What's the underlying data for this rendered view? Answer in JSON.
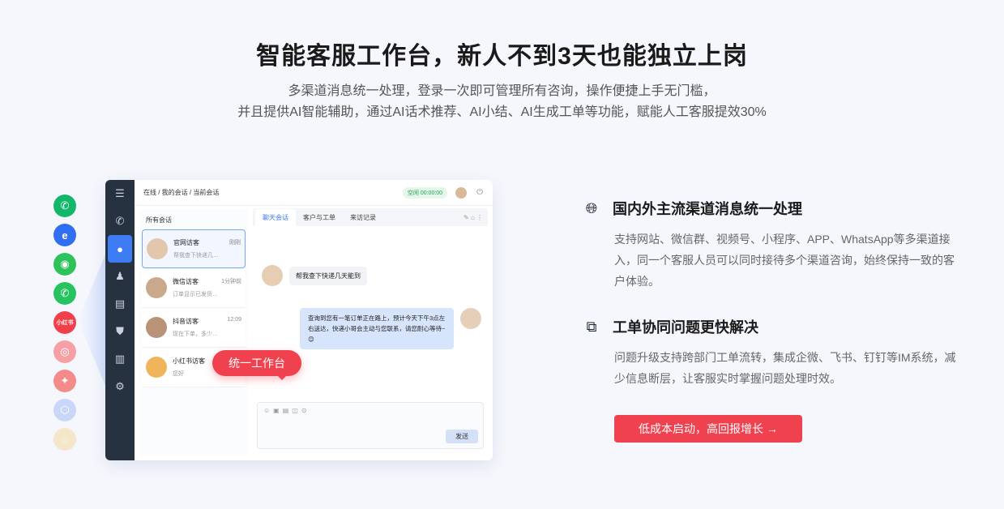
{
  "hero": {
    "title": "智能客服工作台，新人不到3天也能独立上岗",
    "subtitle_line1": "多渠道消息统一处理，登录一次即可管理所有咨询，操作便捷上手无门槛，",
    "subtitle_line2": "并且提供AI智能辅助，通过AI话术推荐、AI小结、AI生成工单等功能，赋能人工客服提效30%"
  },
  "channels": [
    {
      "name": "phone-icon",
      "glyph": "✆"
    },
    {
      "name": "ie-browser-icon",
      "glyph": "e"
    },
    {
      "name": "wechat-icon",
      "glyph": "◉"
    },
    {
      "name": "whatsapp-icon",
      "glyph": "✆"
    },
    {
      "name": "xiaohongshu-icon",
      "glyph": "小红书"
    },
    {
      "name": "instagram-icon",
      "glyph": "◎"
    },
    {
      "name": "bird-icon",
      "glyph": "✦"
    },
    {
      "name": "cube-icon",
      "glyph": "⬡"
    },
    {
      "name": "faded-channel-icon",
      "glyph": "◌"
    }
  ],
  "app": {
    "breadcrumb": "在线 / 我的会话 / 当前会话",
    "status": "空闲  00:00:00",
    "list_title": "所有会话",
    "conversations": [
      {
        "name": "官网访客",
        "time": "刚刚",
        "preview": "帮我查下快递几…"
      },
      {
        "name": "微信访客",
        "time": "1分钟前",
        "preview": "订单显示已发货…"
      },
      {
        "name": "抖音访客",
        "time": "12:09",
        "preview": "现在下单，多少…"
      },
      {
        "name": "小红书访客",
        "time": "",
        "preview": "您好"
      }
    ],
    "tabs": [
      "聊天会话",
      "客户与工单",
      "来访记录"
    ],
    "msg_in": "帮我查下快递几天能到",
    "msg_out": "查询到您有一笔订单正在路上，预计今天下午3点左右送达，快递小哥会主动与您联系，请您耐心等待~😊",
    "send_label": "发送",
    "badge": "统一工作台"
  },
  "features": [
    {
      "icon": "globe-icon",
      "title": "国内外主流渠道消息统一处理",
      "desc": "支持网站、微信群、视频号、小程序、APP、WhatsApp等多渠道接入，同一个客服人员可以同时接待多个渠道咨询，始终保持一致的客户体验。"
    },
    {
      "icon": "ticket-chart-icon",
      "title": "工单协同问题更快解决",
      "desc": "问题升级支持跨部门工单流转，集成企微、飞书、钉钉等IM系统，减少信息断层，让客服实时掌握问题处理时效。"
    }
  ],
  "cta": "低成本启动，高回报增长 →",
  "colors": {
    "accent": "#f0414f",
    "primary": "#3a78f0",
    "rail": "#273240"
  }
}
